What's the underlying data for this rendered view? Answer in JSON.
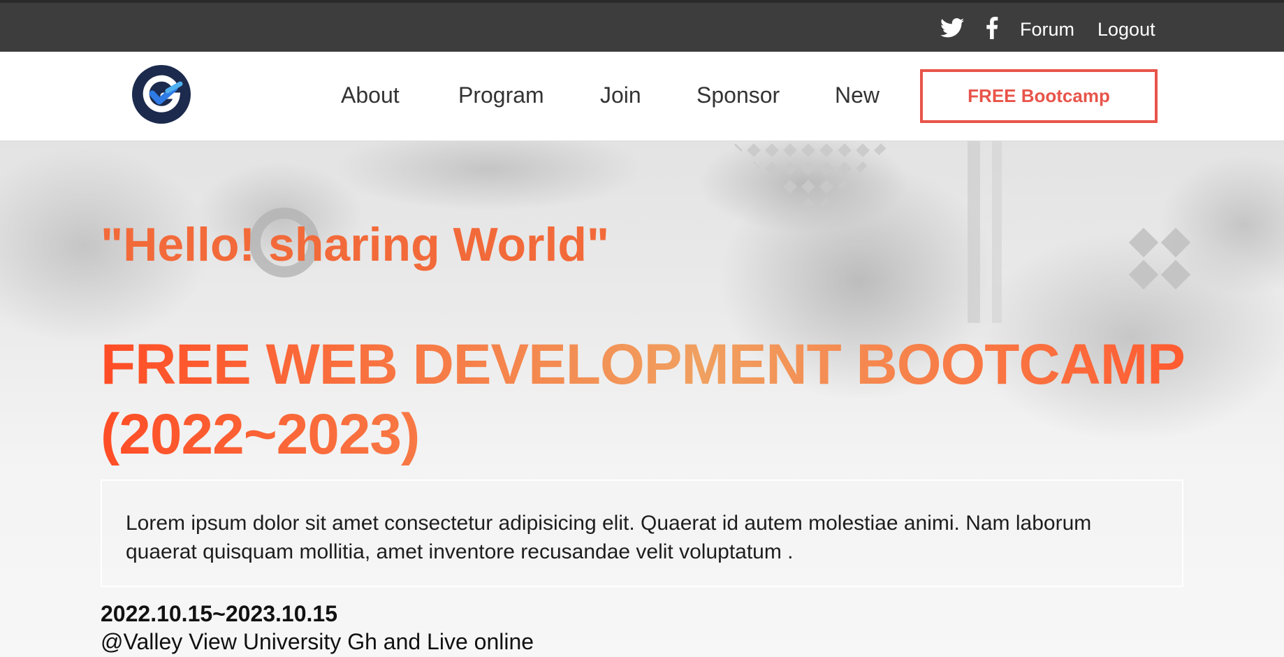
{
  "top_bar": {
    "icons": [
      "twitter-icon",
      "facebook-icon"
    ],
    "links": [
      "Forum",
      "Logout"
    ]
  },
  "nav": {
    "logo_icon": "logo-g-check",
    "items": [
      "About",
      "Program",
      "Join",
      "Sponsor",
      "New"
    ],
    "cta_label": "FREE Bootcamp"
  },
  "hero": {
    "tagline": "\"Hello! sharing World\"",
    "headline_line1": "FREE WEB DEVELOPMENT BOOTCAMP",
    "headline_line2": "(2022~2023)",
    "description": "Lorem ipsum dolor sit amet consectetur adipisicing elit. Quaerat id autem molestiae animi. Nam laborum quaerat quisquam mollitia, amet inventore recusandae velit voluptatum .",
    "dates": "2022.10.15~2023.10.15",
    "venue": "@Valley View University Gh and Live online"
  },
  "colors": {
    "topbar_bg": "#3d3d3d",
    "accent": "#e8544a",
    "tagline": "#f26a3a",
    "logo_navy": "#1c2a4d",
    "logo_blue": "#2f7be5"
  }
}
